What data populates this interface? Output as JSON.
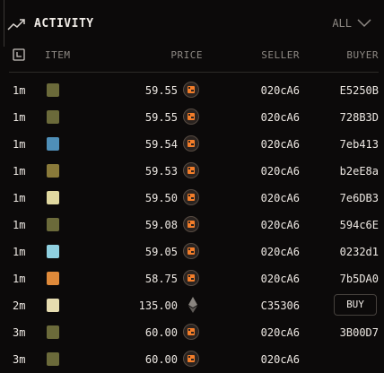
{
  "header": {
    "title": "ACTIVITY",
    "filter_label": "ALL",
    "title_icon": "trending-up-icon",
    "filter_icon": "chevron-down-icon"
  },
  "columns": {
    "time_icon": "clock-icon",
    "item": "ITEM",
    "price": "PRICE",
    "seller": "SELLER",
    "buyer": "BUYER"
  },
  "colors": {
    "background": "#0c0a0a",
    "accent": "#f27d2a",
    "muted": "#8e8984"
  },
  "rows": [
    {
      "time": "1m",
      "thumb": "#6b6a3a",
      "price": "59.55",
      "currency": "token",
      "seller": "020cA6",
      "buyer": "E5250B"
    },
    {
      "time": "1m",
      "thumb": "#6b6a3a",
      "price": "59.55",
      "currency": "token",
      "seller": "020cA6",
      "buyer": "728B3D"
    },
    {
      "time": "1m",
      "thumb": "#4f8fb8",
      "price": "59.54",
      "currency": "token",
      "seller": "020cA6",
      "buyer": "7eb413"
    },
    {
      "time": "1m",
      "thumb": "#8a7a3a",
      "price": "59.53",
      "currency": "token",
      "seller": "020cA6",
      "buyer": "b2eE8a"
    },
    {
      "time": "1m",
      "thumb": "#e0d8a0",
      "price": "59.50",
      "currency": "token",
      "seller": "020cA6",
      "buyer": "7e6DB3"
    },
    {
      "time": "1m",
      "thumb": "#6b6a3a",
      "price": "59.08",
      "currency": "token",
      "seller": "020cA6",
      "buyer": "594c6E"
    },
    {
      "time": "1m",
      "thumb": "#8fd0e0",
      "price": "59.05",
      "currency": "token",
      "seller": "020cA6",
      "buyer": "0232d1"
    },
    {
      "time": "1m",
      "thumb": "#e08a3a",
      "price": "58.75",
      "currency": "token",
      "seller": "020cA6",
      "buyer": "7b5DA0"
    },
    {
      "time": "2m",
      "thumb": "#e6dcb0",
      "price": "135.00",
      "currency": "eth",
      "seller": "C35306",
      "buyer": "",
      "action": "BUY"
    },
    {
      "time": "3m",
      "thumb": "#6b6a3a",
      "price": "60.00",
      "currency": "token",
      "seller": "020cA6",
      "buyer": "3B00D7"
    },
    {
      "time": "3m",
      "thumb": "#6b6a3a",
      "price": "60.00",
      "currency": "token",
      "seller": "020cA6",
      "buyer": ""
    }
  ]
}
